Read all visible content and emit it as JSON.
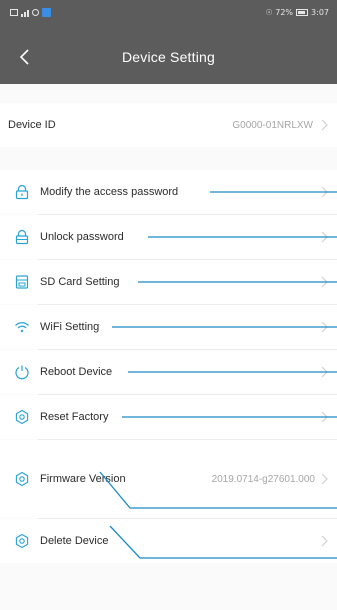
{
  "status_bar": {
    "carrier_text": "▤⁴ıl ☉",
    "right_text": "☉ 72%",
    "time": "3:07",
    "app_icon_color": "#3a8ee6"
  },
  "header": {
    "title": "Device Setting",
    "back_icon": "chevron-left-icon",
    "background": "#5c5c5c"
  },
  "device_id": {
    "label": "Device ID",
    "value": "G0000-01NRLXW"
  },
  "menu": {
    "items": [
      {
        "label": "Modify the access password",
        "icon": "lock-icon"
      },
      {
        "label": "Unlock password",
        "icon": "unlock-icon"
      },
      {
        "label": "SD Card Setting",
        "icon": "sd-card-icon"
      },
      {
        "label": "WiFi Setting",
        "icon": "wifi-icon"
      },
      {
        "label": "Reboot Device",
        "icon": "power-icon"
      },
      {
        "label": "Reset Factory",
        "icon": "reset-gear-icon"
      },
      {
        "label": "Firmware Version",
        "icon": "firmware-gear-icon",
        "value": "2019.0714-g27601.000"
      },
      {
        "label": "Delete Device",
        "icon": "delete-gear-icon"
      }
    ]
  },
  "colors": {
    "accent_icon": "#2aa3d6",
    "annotation_line": "#1a8bc4",
    "chevron": "#cccccc"
  }
}
